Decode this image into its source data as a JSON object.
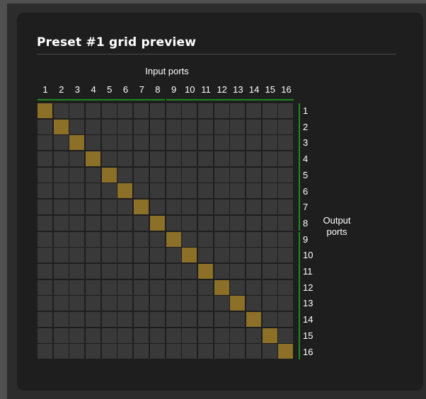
{
  "title": "Preset #1 grid preview",
  "input_label": "Input ports",
  "output_label": "Output\nports",
  "inputs": [
    "1",
    "2",
    "3",
    "4",
    "5",
    "6",
    "7",
    "8",
    "9",
    "10",
    "11",
    "12",
    "13",
    "14",
    "15",
    "16"
  ],
  "outputs": [
    "1",
    "2",
    "3",
    "4",
    "5",
    "6",
    "7",
    "8",
    "9",
    "10",
    "11",
    "12",
    "13",
    "14",
    "15",
    "16"
  ],
  "connections": [
    {
      "input": 1,
      "output": 1
    },
    {
      "input": 2,
      "output": 2
    },
    {
      "input": 3,
      "output": 3
    },
    {
      "input": 4,
      "output": 4
    },
    {
      "input": 5,
      "output": 5
    },
    {
      "input": 6,
      "output": 6
    },
    {
      "input": 7,
      "output": 7
    },
    {
      "input": 8,
      "output": 8
    },
    {
      "input": 9,
      "output": 9
    },
    {
      "input": 10,
      "output": 10
    },
    {
      "input": 11,
      "output": 11
    },
    {
      "input": 12,
      "output": 12
    },
    {
      "input": 13,
      "output": 13
    },
    {
      "input": 14,
      "output": 14
    },
    {
      "input": 15,
      "output": 15
    },
    {
      "input": 16,
      "output": 16
    }
  ],
  "colors": {
    "connected": "#8c7028",
    "empty": "#393939",
    "group_bar": "#1e8a1e"
  }
}
